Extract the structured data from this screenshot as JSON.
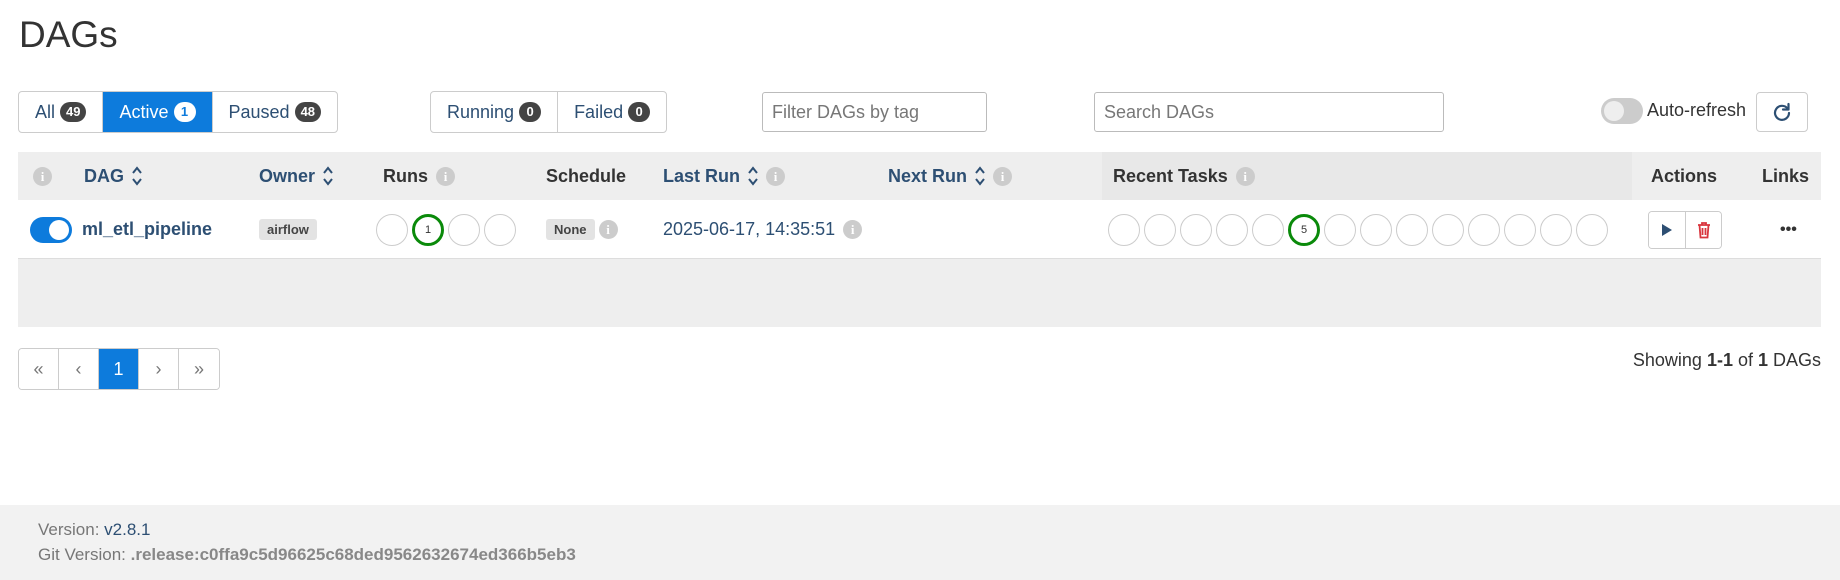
{
  "page": {
    "title": "DAGs"
  },
  "filters": {
    "status": [
      {
        "label": "All",
        "count": "49"
      },
      {
        "label": "Active",
        "count": "1"
      },
      {
        "label": "Paused",
        "count": "48"
      }
    ],
    "state": [
      {
        "label": "Running",
        "count": "0"
      },
      {
        "label": "Failed",
        "count": "0"
      }
    ],
    "tag_placeholder": "Filter DAGs by tag",
    "search_placeholder": "Search DAGs",
    "auto_refresh_label": "Auto-refresh"
  },
  "table": {
    "columns": {
      "dag": "DAG",
      "owner": "Owner",
      "runs": "Runs",
      "schedule": "Schedule",
      "last_run": "Last Run",
      "next_run": "Next Run",
      "recent_tasks": "Recent Tasks",
      "actions": "Actions",
      "links": "Links"
    },
    "rows": [
      {
        "dag_id": "ml_etl_pipeline",
        "owner": "airflow",
        "runs_count": "1",
        "schedule": "None",
        "last_run": "2025-06-17, 14:35:51",
        "next_run": "",
        "recent_tasks_count": "5",
        "links_icon": "•••"
      }
    ]
  },
  "pagination": {
    "first": "«",
    "prev": "‹",
    "current": "1",
    "next": "›",
    "last": "»",
    "showing_prefix": "Showing ",
    "showing_range": "1-1",
    "showing_of": " of ",
    "showing_total": "1",
    "showing_suffix": " DAGs"
  },
  "footer": {
    "version_label": "Version: ",
    "version": "v2.8.1",
    "git_label": "Git Version: ",
    "git_version": ".release:c0ffa9c5d96625c68ded9562632674ed366b5eb3"
  },
  "icons": {
    "info": "i",
    "play": "play-icon",
    "delete": "trash-icon",
    "refresh": "refresh-icon"
  },
  "colors": {
    "primary": "#0d7bdc",
    "success": "#0a8a0a",
    "danger": "#d9363e",
    "link": "#2d4f73"
  }
}
